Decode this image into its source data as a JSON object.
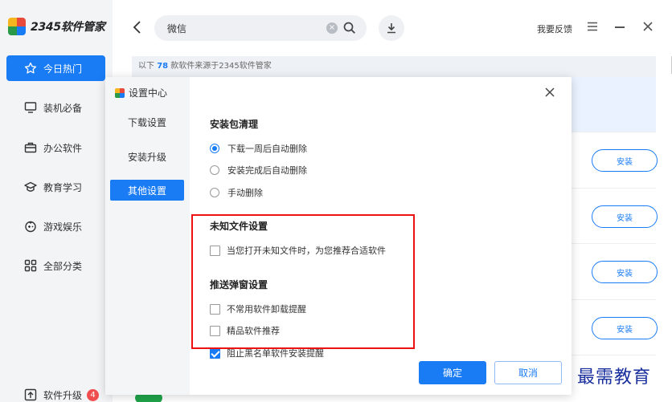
{
  "app": {
    "brand_text": "2345软件管家"
  },
  "sidebar": {
    "items": [
      {
        "label": "今日热门",
        "icon": "star-icon",
        "active": true
      },
      {
        "label": "装机必备",
        "icon": "monitor-icon"
      },
      {
        "label": "办公软件",
        "icon": "briefcase-icon"
      },
      {
        "label": "教育学习",
        "icon": "graduation-cap-icon"
      },
      {
        "label": "游戏娱乐",
        "icon": "gamepad-icon"
      },
      {
        "label": "全部分类",
        "icon": "grid-icon"
      }
    ],
    "upgrade": {
      "label": "软件升级",
      "badge": "4",
      "icon": "upgrade-icon"
    }
  },
  "topbar": {
    "search_value": "微信",
    "feedback_label": "我要反馈"
  },
  "main": {
    "info_prefix": "以下",
    "info_count": "78",
    "info_suffix": "款软件来源于2345软件管家",
    "install_label": "安装"
  },
  "dialog": {
    "title": "设置中心",
    "tabs": [
      "下载设置",
      "安装升级",
      "其他设置"
    ],
    "active_tab": 2,
    "section1": {
      "title": "安装包清理",
      "options": [
        "下载一周后自动删除",
        "安装完成后自动删除",
        "手动删除"
      ],
      "selected": 0
    },
    "section2": {
      "title": "未知文件设置",
      "option": "当您打开未知文件时，为您推荐合适软件",
      "checked": false
    },
    "section3": {
      "title": "推送弹窗设置",
      "options": [
        {
          "label": "不常用软件卸载提醒",
          "checked": false
        },
        {
          "label": "精品软件推荐",
          "checked": false
        },
        {
          "label": "阻止黑名单软件安装提醒",
          "checked": true
        }
      ]
    },
    "ok_label": "确定",
    "cancel_label": "取消"
  },
  "watermark": "最需教育",
  "colors": {
    "accent": "#1a7cf5",
    "highlight_box": "#e11111"
  }
}
